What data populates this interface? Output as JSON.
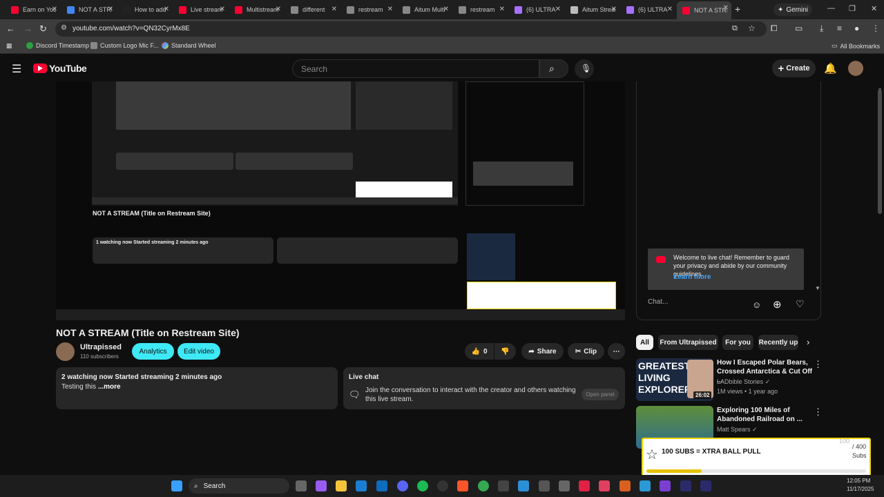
{
  "browser": {
    "tabs": [
      {
        "title": "Earn on YouTube",
        "color": "#ff0033"
      },
      {
        "title": "NOT A STREAM",
        "color": "#4285f4"
      },
      {
        "title": "How to add",
        "color": "#222222"
      },
      {
        "title": "Live stream",
        "color": "#ff0033"
      },
      {
        "title": "Multistream",
        "color": "#ff0033"
      },
      {
        "title": "different",
        "color": "#888888"
      },
      {
        "title": "restream",
        "color": "#888888"
      },
      {
        "title": "Aitum Multi",
        "color": "#888888"
      },
      {
        "title": "restream",
        "color": "#888888"
      },
      {
        "title": "(6) ULTRA",
        "color": "#a970ff"
      },
      {
        "title": "Aitum Stream",
        "color": "#bbbbbb"
      },
      {
        "title": "(6) ULTRA",
        "color": "#a970ff"
      },
      {
        "title": "NOT A STREAM",
        "color": "#ff0033"
      }
    ],
    "gemini_label": "Gemini",
    "url": "youtube.com/watch?v=QN32CyrMx8E",
    "bookmarks": [
      "Discord Timestamp",
      "Custom Logo Mic F...",
      "Standard Wheel"
    ],
    "all_bookmarks": "All Bookmarks"
  },
  "youtube": {
    "logo_text": "YouTube",
    "search_placeholder": "Search",
    "create_label": "Create",
    "video_title": "NOT A STREAM (Title on Restream Site)",
    "channel_name": "Ultrapissed",
    "subscribers": "110 subscribers",
    "analytics_label": "Analytics",
    "edit_video_label": "Edit video",
    "likes": "0",
    "share_label": "Share",
    "clip_label": "Clip",
    "watching": "2 watching now  Started streaming 2 minutes ago",
    "description": "Testing this ",
    "more_label": "...more",
    "live_chat_title": "Live chat",
    "live_chat_text": "Join the conversation to interact with the creator and others watching this live stream.",
    "open_panel": "Open panel",
    "chat_welcome": "Welcome to live chat! Remember to guard your privacy and abide by our community guidelines.",
    "learn_more": "Learn more",
    "chat_placeholder": "Chat...",
    "chips": [
      "All",
      "From Ultrapissed",
      "For you",
      "Recently up"
    ],
    "recs": [
      {
        "title": "How I Escaped Polar Bears, Crossed Antarctica & Cut Off ...",
        "channel": "LADbible Stories",
        "meta": "1M views • 1 year ago",
        "duration": "26:02",
        "thumb_text": "GREATEST LIVING EXPLORER"
      },
      {
        "title": "Exploring 100 Miles of Abandoned Railroad on ...",
        "channel": "Matt Spears",
        "meta": "",
        "duration": "",
        "thumb_text": ""
      }
    ],
    "inner_video_title": "NOT A STREAM (Title on Restream Site)",
    "inner_watching": "1 watching now  Started streaming 2 minutes ago"
  },
  "widget": {
    "label": "100 SUBS = XTRA BALL PULL",
    "current": "100",
    "goal": "/ 400",
    "unit": "Subs",
    "progress": 0.25,
    "bar_color": "#e6c200"
  },
  "taskbar": {
    "search_label": "Search",
    "time": "12:05 PM",
    "date": "11/17/2025"
  }
}
